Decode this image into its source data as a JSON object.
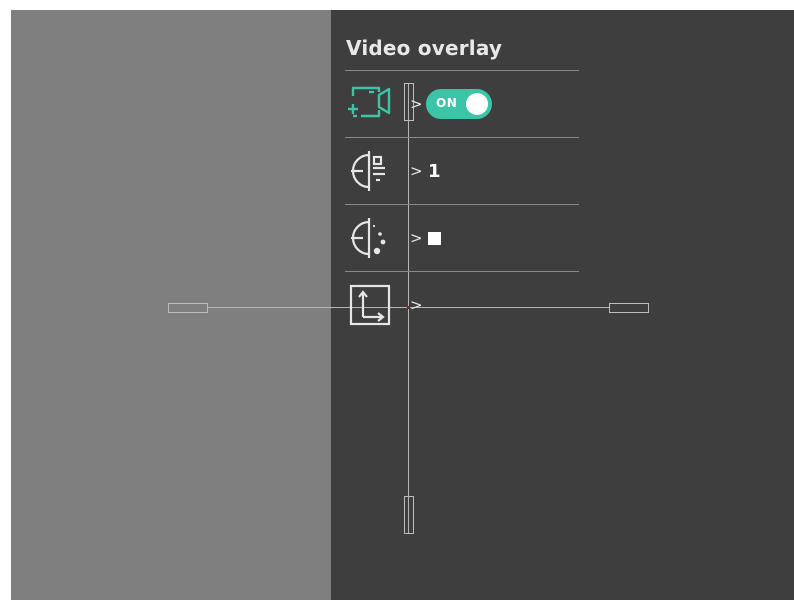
{
  "menu": {
    "title": "Video overlay",
    "items": [
      {
        "icon": "video-record-icon",
        "chevron": ">",
        "toggle_label": "ON",
        "toggle_state": "on"
      },
      {
        "icon": "reticle-type-icon",
        "chevron": ">",
        "value": "1"
      },
      {
        "icon": "reticle-color-icon",
        "chevron": ">",
        "value_swatch": "#ffffff"
      },
      {
        "icon": "reticle-position-icon",
        "chevron": ">"
      }
    ]
  },
  "colors": {
    "accent": "#3cc4a6",
    "left_pane": "#7f7f7f",
    "right_pane": "#3e3e3e"
  }
}
